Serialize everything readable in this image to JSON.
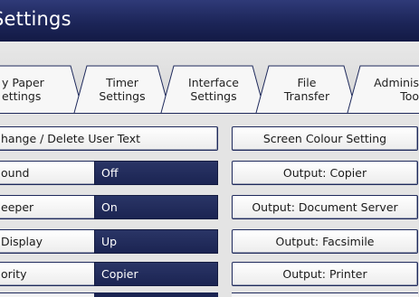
{
  "header": {
    "title": "Settings"
  },
  "tabs": [
    {
      "line1": "y Paper",
      "line2": "ettings"
    },
    {
      "line1": "Timer",
      "line2": "Settings"
    },
    {
      "line1": "Interface",
      "line2": "Settings"
    },
    {
      "line1": "File",
      "line2": "Transfer"
    },
    {
      "line1": "Adminis",
      "line2": "Too"
    }
  ],
  "left": {
    "change_text_button": "hange / Delete User Text",
    "rows": [
      {
        "label": "ound",
        "value": "Off"
      },
      {
        "label": "eeper",
        "value": "On"
      },
      {
        "label": "Display",
        "value": "Up"
      },
      {
        "label": "ority",
        "value": "Copier"
      }
    ]
  },
  "right": {
    "buttons": [
      "Screen Colour Setting",
      "Output: Copier",
      "Output: Document Server",
      "Output: Facsimile",
      "Output: Printer"
    ]
  },
  "colors": {
    "header_bg": "#1c2558",
    "value_bg": "#1b2452",
    "border": "#1f2a5c",
    "content_bg": "#e4e4e4"
  }
}
